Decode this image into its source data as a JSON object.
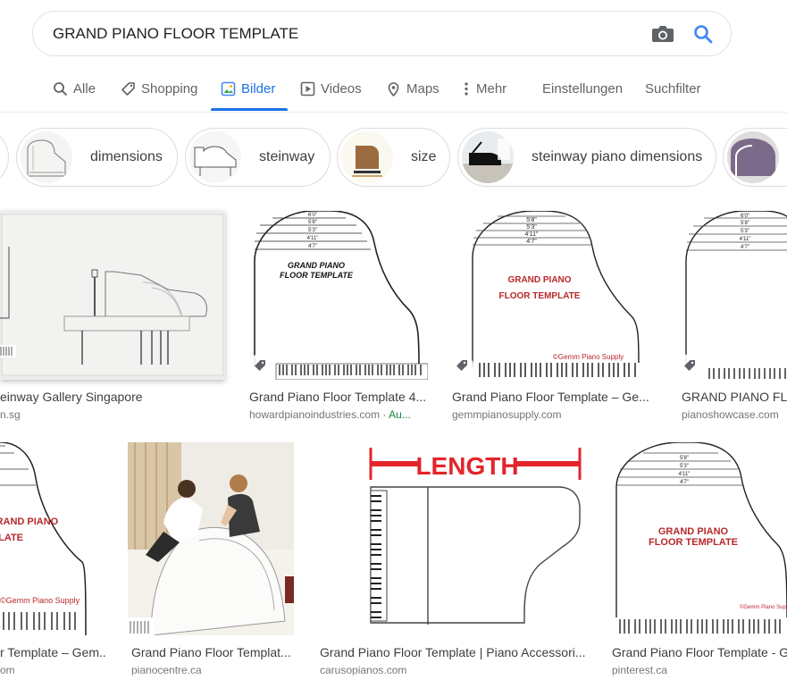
{
  "search": {
    "query": "GRAND PIANO FLOOR TEMPLATE"
  },
  "tabs": [
    {
      "label": "Alle",
      "icon": "search-icon"
    },
    {
      "label": "Shopping",
      "icon": "tag-icon"
    },
    {
      "label": "Bilder",
      "icon": "image-icon",
      "active": true
    },
    {
      "label": "Videos",
      "icon": "video-icon"
    },
    {
      "label": "Maps",
      "icon": "map-pin-icon"
    },
    {
      "label": "Mehr",
      "icon": "more-vert-icon"
    }
  ],
  "tools": {
    "settings": "Einstellungen",
    "filters": "Suchfilter"
  },
  "chips": [
    {
      "label": "dimensions"
    },
    {
      "label": "steinway"
    },
    {
      "label": "size"
    },
    {
      "label": "steinway piano dimensions"
    }
  ],
  "thumb_text": {
    "template_line1": "GRAND PIANO",
    "template_line2": "FLOOR TEMPLATE",
    "gemm": "©Gemm Piano Supply",
    "length": "LENGTH",
    "sizes": [
      "6'0\"",
      "5'8\"",
      "5'3\"",
      "4'11\"",
      "4'7\""
    ]
  },
  "results": [
    {
      "title": "einway Gallery Singapore",
      "source": "n.sg",
      "badge": ""
    },
    {
      "title": "Grand Piano Floor Template 4...",
      "source": "howardpianoindustries.com · ",
      "badge": "Au..."
    },
    {
      "title": "Grand Piano Floor Template – Ge...",
      "source": "gemmpianosupply.com",
      "badge": ""
    },
    {
      "title": "GRAND PIANO FLO",
      "source": "pianoshowcase.com",
      "badge": ""
    },
    {
      "title": "r Template – Gem...",
      "source": "om",
      "badge": ""
    },
    {
      "title": "Grand Piano Floor Templat...",
      "source": "pianocentre.ca",
      "badge": ""
    },
    {
      "title": "Grand Piano Floor Template | Piano Accessori...",
      "source": "carusopianos.com",
      "badge": ""
    },
    {
      "title": "Grand Piano Floor Template - Ge",
      "source": "pinterest.ca",
      "badge": ""
    }
  ],
  "colors": {
    "accent": "#1a73e8",
    "length_red": "#e3252b",
    "badge_green": "#188038"
  }
}
